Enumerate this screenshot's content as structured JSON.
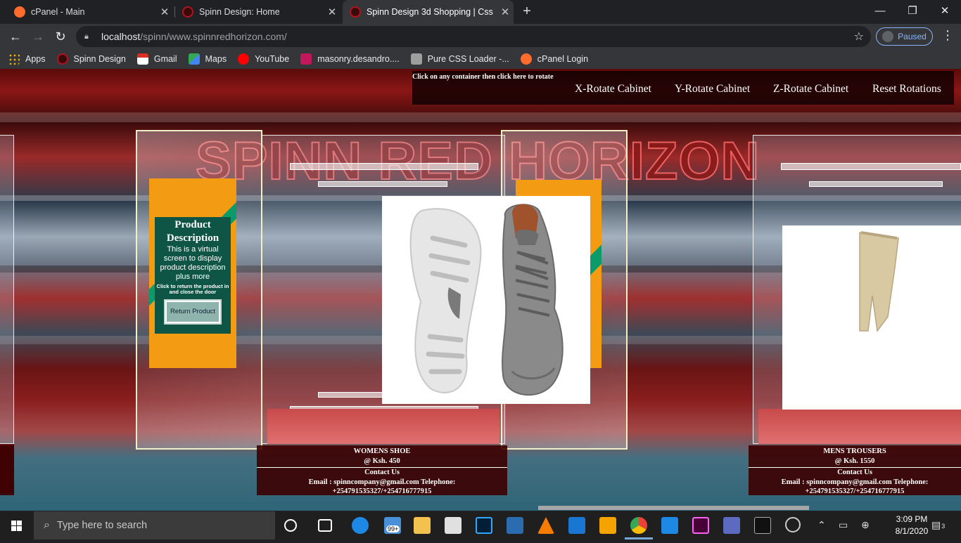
{
  "tabs": [
    {
      "title": "cPanel - Main",
      "active": false
    },
    {
      "title": "Spinn Design: Home",
      "active": false
    },
    {
      "title": "Spinn Design 3d Shopping | Css",
      "active": true
    }
  ],
  "window": {
    "minimize": "—",
    "maximize": "❐",
    "close": "✕"
  },
  "address": {
    "host": "localhost",
    "path": "/spinn/www.spinnredhorizon.com/",
    "profile_status": "Paused"
  },
  "bookmarks": [
    {
      "label": "Apps",
      "color": "#f2b400"
    },
    {
      "label": "Spinn Design",
      "color": "#b3121f"
    },
    {
      "label": "Gmail",
      "color": "#d93025"
    },
    {
      "label": "Maps",
      "color": "#34a853"
    },
    {
      "label": "YouTube",
      "color": "#ff0000"
    },
    {
      "label": "masonry.desandro....",
      "color": "#c2185b"
    },
    {
      "label": "Pure CSS Loader -...",
      "color": "#9e9e9e"
    },
    {
      "label": "cPanel Login",
      "color": "#ff6c2c"
    }
  ],
  "page": {
    "brand": "SPINN RED HORIZON",
    "menu_hint": "Click on any container then click here to rotate",
    "menu": [
      "X-Rotate Cabinet",
      "Y-Rotate Cabinet",
      "Z-Rotate Cabinet",
      "Reset Rotations"
    ],
    "description_card": {
      "title": "Product Description",
      "body": "This is a virtual screen to display product description plus more",
      "note": "Click to return the product in and close the door",
      "button": "Return Product"
    },
    "products": [
      {
        "name": "WOMENS SHOE",
        "price": "@ Ksh. 450",
        "contact_heading": "Contact Us",
        "contact_line1": "Email : spinncompany@gmail.com Telephone:",
        "contact_line2": "+254791535327/+254716777915"
      },
      {
        "name": "MENS TROUSERS",
        "price": "@ Ksh. 1550",
        "contact_heading": "Contact Us",
        "contact_line1": "Email : spinncompany@gmail.com Telephone:",
        "contact_line2": "+254791535327/+254716777915"
      }
    ]
  },
  "taskbar": {
    "search_placeholder": "Type here to search",
    "mail_badge": "99+",
    "time": "3:09 PM",
    "date": "8/1/2020",
    "notification_count": "3"
  }
}
